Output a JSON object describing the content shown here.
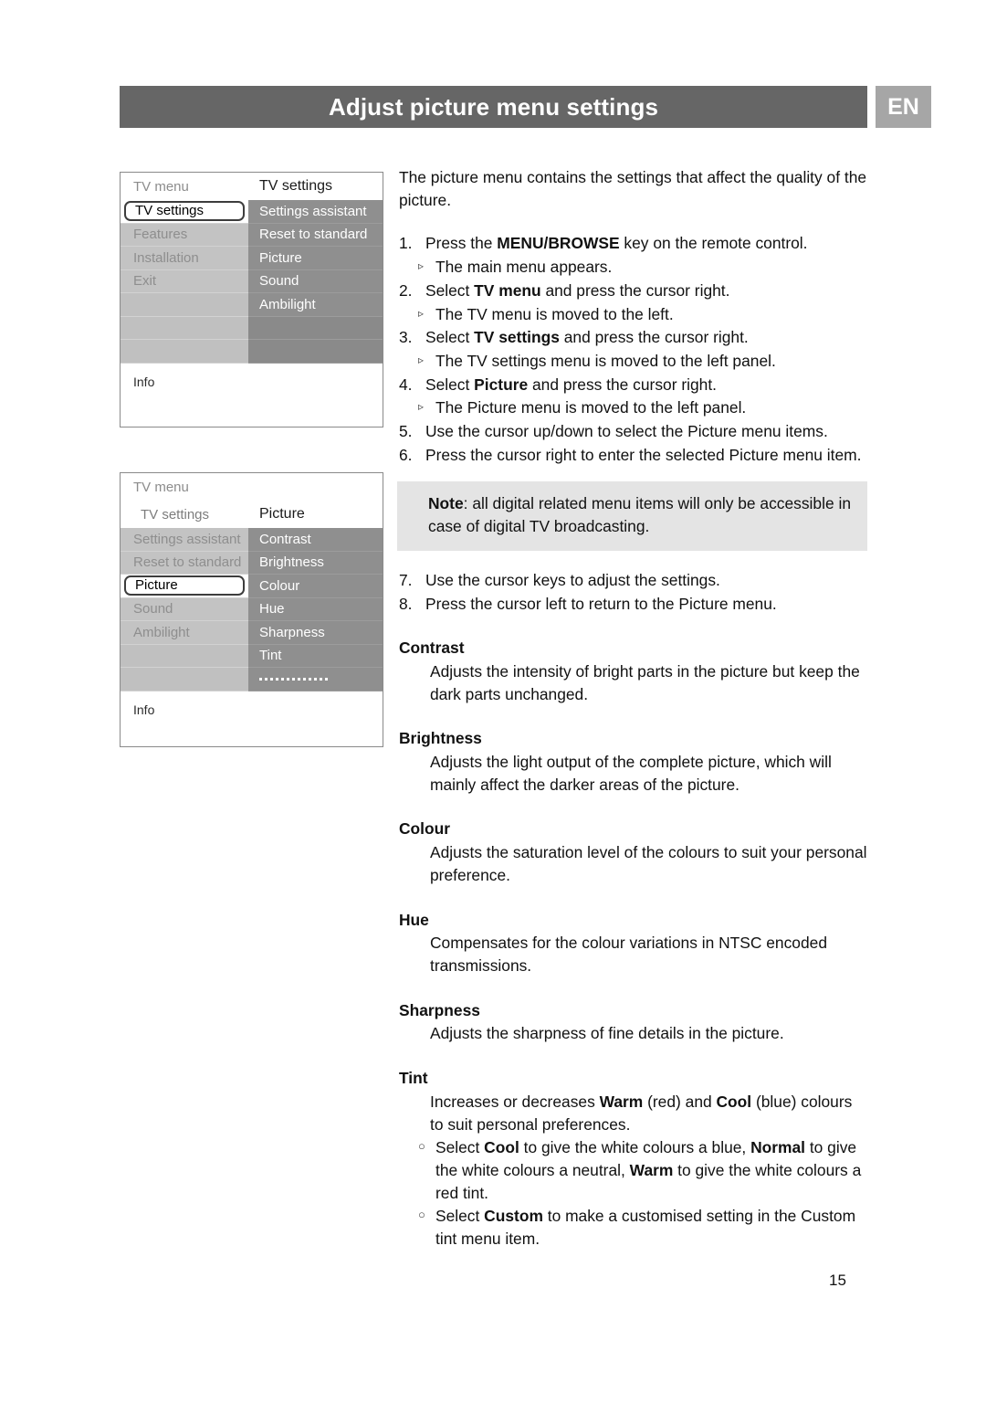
{
  "header": {
    "title": "Adjust picture menu settings",
    "language": "EN"
  },
  "page_number": "15",
  "menu_mock_1": {
    "header_left": "TV menu",
    "header_right": "TV settings",
    "left_items": [
      "TV settings",
      "Features",
      "Installation",
      "Exit"
    ],
    "left_selected": "TV settings",
    "right_items": [
      "Settings assistant",
      "Reset to standard",
      "Picture",
      "Sound",
      "Ambilight"
    ],
    "info_label": "Info"
  },
  "menu_mock_2": {
    "header_top": "TV menu",
    "header_left": "TV settings",
    "header_right": "Picture",
    "left_items": [
      "Settings assistant",
      "Reset to standard",
      "Picture",
      "Sound",
      "Ambilight"
    ],
    "left_selected": "Picture",
    "right_items": [
      "Contrast",
      "Brightness",
      "Colour",
      "Hue",
      "Sharpness",
      "Tint"
    ],
    "right_dots": "·············",
    "info_label": "Info"
  },
  "body": {
    "intro": "The picture menu contains the settings that affect the quality of the picture.",
    "steps": [
      {
        "num": "1.",
        "text_parts": [
          {
            "t": "Press the ",
            "b": false
          },
          {
            "t": "MENU/BROWSE",
            "b": true
          },
          {
            "t": " key on the remote control.",
            "b": false
          }
        ],
        "sub": [
          {
            "mark": "▹",
            "text": "The main menu appears."
          }
        ]
      },
      {
        "num": "2.",
        "text_parts": [
          {
            "t": "Select ",
            "b": false
          },
          {
            "t": "TV menu",
            "b": true
          },
          {
            "t": " and press the cursor right.",
            "b": false
          }
        ],
        "sub": [
          {
            "mark": "▹",
            "text": "The TV menu is moved to the left."
          }
        ]
      },
      {
        "num": "3.",
        "text_parts": [
          {
            "t": "Select ",
            "b": false
          },
          {
            "t": "TV settings",
            "b": true
          },
          {
            "t": " and press the cursor right.",
            "b": false
          }
        ],
        "sub": [
          {
            "mark": "▹",
            "text": "The TV settings menu is moved to the left panel."
          }
        ]
      },
      {
        "num": "4.",
        "text_parts": [
          {
            "t": "Select ",
            "b": false
          },
          {
            "t": "Picture",
            "b": true
          },
          {
            "t": " and press the cursor right.",
            "b": false
          }
        ],
        "sub": [
          {
            "mark": "▹",
            "text": "The Picture menu is moved to the left panel."
          }
        ]
      },
      {
        "num": "5.",
        "text_parts": [
          {
            "t": "Use the cursor up/down to select the Picture menu items.",
            "b": false
          }
        ],
        "sub": []
      },
      {
        "num": "6.",
        "text_parts": [
          {
            "t": "Press the cursor right to enter the selected Picture menu item.",
            "b": false
          }
        ],
        "sub": []
      }
    ],
    "note": {
      "label": "Note",
      "text": ": all digital related menu items will only be accessible in case of digital TV broadcasting."
    },
    "steps_after_note": [
      {
        "num": "7.",
        "text": "Use the cursor keys to adjust the settings."
      },
      {
        "num": "8.",
        "text": "Press the cursor left to return to the Picture menu."
      }
    ],
    "terms": [
      {
        "title": "Contrast",
        "body": "Adjusts the intensity of bright parts in the picture but keep the dark parts unchanged."
      },
      {
        "title": "Brightness",
        "body": "Adjusts the light output of the complete picture, which will mainly affect the darker areas of the picture."
      },
      {
        "title": "Colour",
        "body": "Adjusts the saturation level of the colours to suit your personal preference."
      },
      {
        "title": "Hue",
        "body": "Compensates for the colour variations in NTSC encoded transmissions."
      },
      {
        "title": "Sharpness",
        "body": "Adjusts the sharpness of fine details in the picture."
      }
    ],
    "tint": {
      "title": "Tint",
      "intro_parts": [
        {
          "t": "Increases or decreases ",
          "b": false
        },
        {
          "t": "Warm",
          "b": true
        },
        {
          "t": " (red) and ",
          "b": false
        },
        {
          "t": "Cool",
          "b": true
        },
        {
          "t": " (blue) colours to suit personal preferences.",
          "b": false
        }
      ],
      "bullets": [
        {
          "mark": "○",
          "parts": [
            {
              "t": "Select ",
              "b": false
            },
            {
              "t": "Cool",
              "b": true
            },
            {
              "t": " to give the white colours a blue, ",
              "b": false
            },
            {
              "t": "Normal",
              "b": true
            },
            {
              "t": " to give the white colours a neutral, ",
              "b": false
            },
            {
              "t": "Warm",
              "b": true
            },
            {
              "t": " to give the white colours a red tint.",
              "b": false
            }
          ]
        },
        {
          "mark": "○",
          "parts": [
            {
              "t": "Select ",
              "b": false
            },
            {
              "t": "Custom",
              "b": true
            },
            {
              "t": " to make a customised setting in the Custom tint menu item.",
              "b": false
            }
          ]
        }
      ]
    }
  }
}
